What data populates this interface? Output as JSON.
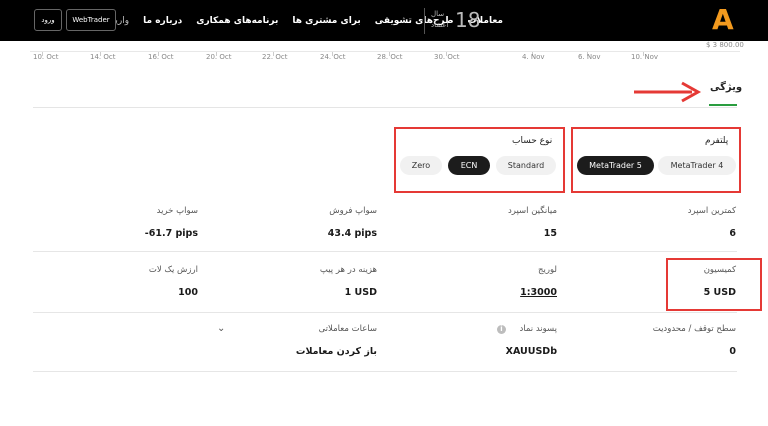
{
  "navbar": {
    "logo_letter": "A",
    "links": [
      "معاملات",
      "طرح‌های تشویقی",
      "برای مشتری ها",
      "برنامه‌های همکاری",
      "درباره ما",
      "واریز"
    ],
    "years_number": "18",
    "years_line1": "سال",
    "years_line2": "اعتماد",
    "webtrader_label": "WebTrader",
    "login_label": "ورود"
  },
  "chart_axis": {
    "price_label": "$ 3 800.00",
    "dates": [
      "10. Oct",
      "14. Oct",
      "16. Oct",
      "20. Oct",
      "22. Oct",
      "24. Oct",
      "28. Oct",
      "30. Oct",
      "4. Nov",
      "6. Nov",
      "10. Nov"
    ]
  },
  "features_tab": {
    "title": "ویژگی"
  },
  "platform": {
    "title": "پلتفرم",
    "options": [
      "MetaTrader 4",
      "MetaTrader 5"
    ],
    "selected": "MetaTrader 5"
  },
  "account_type": {
    "title": "نوع حساب",
    "options": [
      "Standard",
      "ECN",
      "Zero"
    ],
    "selected": "ECN"
  },
  "specs": {
    "min_spread_label": "کمترین اسپرد",
    "min_spread_value": "6",
    "avg_spread_label": "میانگین اسپرد",
    "avg_spread_value": "15",
    "swap_sell_label": "سواپ فروش",
    "swap_sell_value": "43.4 pips",
    "swap_buy_label": "سواپ خرید",
    "swap_buy_value": "-61.7 pips",
    "commission_label": "کمیسیون",
    "commission_value": "5 USD",
    "leverage_label": "لوریج",
    "leverage_value": "1:3000",
    "pip_cost_label": "هزینه در هر پیپ",
    "pip_cost_value": "1 USD",
    "lot_value_label": "ارزش یک لات",
    "lot_value_value": "100",
    "stop_level_label": "سطح توقف / محدودیت",
    "stop_level_value": "0",
    "symbol_suffix_label": "پسوند نماد",
    "symbol_suffix_value": "XAUUSDb",
    "trading_hours_label": "ساعات معاملاتی",
    "trading_hours_value": "باز کردن معاملات"
  },
  "colors": {
    "brand": "#f39a1e",
    "accent_green": "#2a9d3f",
    "annotation_red": "#e53935"
  }
}
